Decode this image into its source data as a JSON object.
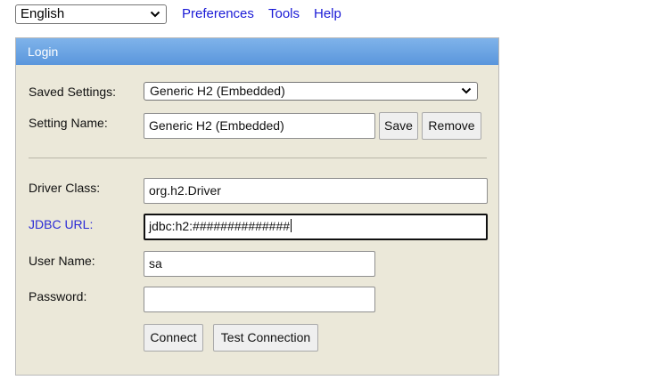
{
  "topbar": {
    "language": "English",
    "links": {
      "preferences": "Preferences",
      "tools": "Tools",
      "help": "Help"
    }
  },
  "login": {
    "title": "Login",
    "saved_settings": {
      "label": "Saved Settings:",
      "value": "Generic H2 (Embedded)"
    },
    "setting_name": {
      "label": "Setting Name:",
      "value": "Generic H2 (Embedded)",
      "save_label": "Save",
      "remove_label": "Remove"
    },
    "driver_class": {
      "label": "Driver Class:",
      "value": "org.h2.Driver"
    },
    "jdbc_url": {
      "label": "JDBC URL:",
      "value": "jdbc:h2:##############"
    },
    "user_name": {
      "label": "User Name:",
      "value": "sa"
    },
    "password": {
      "label": "Password:",
      "value": ""
    },
    "connect_label": "Connect",
    "test_connection_label": "Test Connection"
  },
  "colors": {
    "header_gradient_top": "#7fb3ea",
    "header_gradient_bottom": "#5a96dc",
    "panel_background": "#ebe8d9",
    "link_blue": "#1a1ad6"
  },
  "icons": {
    "dropdown": "chevron-down-icon"
  }
}
